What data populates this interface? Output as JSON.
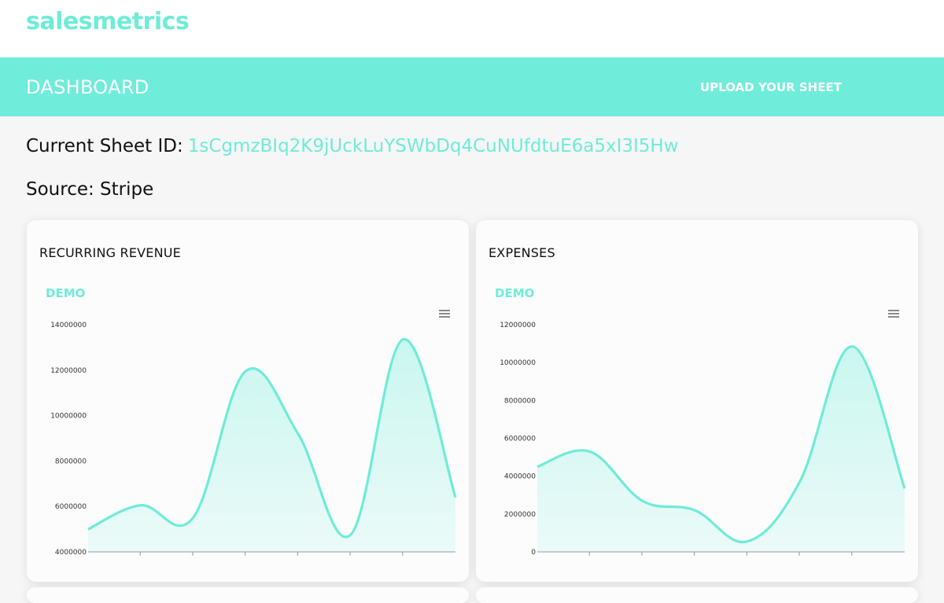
{
  "brand": "salesmetrics",
  "nav": {
    "title": "DASHBOARD",
    "upload_label": "UPLOAD YOUR SHEET"
  },
  "sheet": {
    "label": "Current Sheet ID:",
    "id": "1sCgmzBIq2K9jUckLuYSWbDq4CuNUfdtuE6a5xI3I5Hw",
    "source_label": "Source: Stripe"
  },
  "colors": {
    "accent": "#6eecd6",
    "nav_bg": "#70ecda"
  },
  "icons": {
    "chart_menu": "hamburger-menu-icon"
  },
  "cards": [
    {
      "title": "RECURRING REVENUE",
      "subtitle": "DEMO"
    },
    {
      "title": "EXPENSES",
      "subtitle": "DEMO"
    }
  ],
  "chart_data": [
    {
      "type": "area",
      "title": "RECURRING REVENUE",
      "subtitle": "DEMO",
      "y_ticks": [
        "14000000",
        "12000000",
        "10000000",
        "8000000",
        "6000000",
        "4000000"
      ],
      "ylim": [
        4000000,
        14000000
      ],
      "x_labels": [],
      "values": [
        5000000,
        6050000,
        5500000,
        11950000,
        9200000,
        4750000,
        13350000,
        6400000
      ],
      "grid": false
    },
    {
      "type": "area",
      "title": "EXPENSES",
      "subtitle": "DEMO",
      "y_ticks": [
        "12000000",
        "10000000",
        "8000000",
        "6000000",
        "4000000",
        "2000000",
        "0"
      ],
      "ylim": [
        0,
        12000000
      ],
      "x_labels": [],
      "values": [
        4500000,
        5300000,
        2700000,
        2200000,
        550000,
        3700000,
        10850000,
        3350000
      ],
      "grid": false
    }
  ]
}
